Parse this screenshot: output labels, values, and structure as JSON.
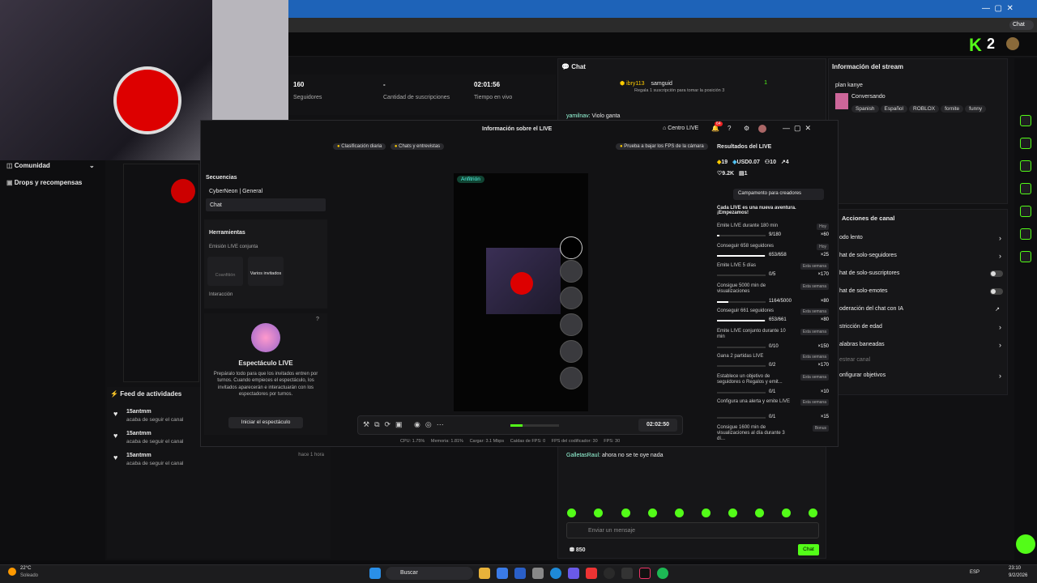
{
  "stats": [
    {
      "value": "160",
      "label": "Seguidores"
    },
    {
      "value": "-",
      "label": "Cantidad de suscripciones"
    },
    {
      "value": "02:01:56",
      "label": "Tiempo en vivo"
    }
  ],
  "leftnav": {
    "community": "Comunidad",
    "drops": "Drops y recompensas"
  },
  "chat": {
    "title": "Chat",
    "gift_user": "ibry113",
    "gift_count": "4",
    "gift_target": "samguid",
    "gift_rank": "1",
    "gift_text": "Regala 1 suscripción para tomar la posición 3",
    "messages": [
      {
        "user": "yamilnav:",
        "text": "Violo ganta"
      },
      {
        "user": "GalletasRaul:",
        "text": "ahora no se te oye nada"
      }
    ],
    "input_placeholder": "Enviar un mensaje",
    "points": "850",
    "send_label": "Chat"
  },
  "stream_info": {
    "title": "Información del stream",
    "streamer": "plan kanye",
    "category": "Conversando",
    "tags": [
      "Spanish",
      "Español",
      "ROBLOX",
      "fornite",
      "funny"
    ]
  },
  "actions": {
    "title": "Acciones de canal",
    "items": [
      {
        "label": "odo lento",
        "type": "arrow"
      },
      {
        "label": "hat de solo-seguidores",
        "type": "arrow"
      },
      {
        "label": "hat de solo-suscriptores",
        "type": "toggle"
      },
      {
        "label": "hat de solo-emotes",
        "type": "toggle"
      },
      {
        "label": "oderación del chat con IA",
        "type": "ext"
      },
      {
        "label": "stricción de edad",
        "type": "arrow"
      },
      {
        "label": "alabras baneadas",
        "type": "arrow"
      },
      {
        "label": "estear canal",
        "type": "none"
      },
      {
        "label": "onfigurar objetivos",
        "type": "arrow"
      }
    ]
  },
  "modal": {
    "title": "Información sobre el LIVE",
    "centro": "Centro LIVE",
    "notif_count": "64",
    "tabs": [
      "Clasificación diaria",
      "Chats y entrevistas"
    ],
    "fps_tip": "Prueba a bajar los FPS de la cámara",
    "sequences_title": "Secuencias",
    "sequences": [
      "CyberNeon | General",
      "Chat"
    ],
    "tools_title": "Herramientas",
    "joint_live": "Emisión LIVE conjunta",
    "cohost": "Coanfitión",
    "multi_guests": "Varios invitados",
    "interaction": "Interacción",
    "show_title": "Espectáculo LIVE",
    "show_desc": "Prepáralo todo para que los invitados entren por turnos. Cuando empieces el espectáculo, los invitados aparecerán e interactuarán con los espectadores por turnos.",
    "show_button": "Iniciar el espectáculo",
    "host_badge": "Anfitrión",
    "timer": "02:02:50",
    "status_bar": "CPU: 1.75%     Memoria: 1.81%     Cargar: 3.1 Mbps     Caídas de FPS: 0     FPS del codificador: 30     FPS: 30"
  },
  "results": {
    "title": "Resultados del LIVE",
    "gifts": "19",
    "usd": "USD0.07",
    "viewers": "10",
    "shares": "4",
    "likes": "9.2K",
    "gifters": "1",
    "campaign": "Campamento para creadores",
    "intro": "Cada LIVE es una nueva aventura. ¡Empezamos!",
    "missions": [
      {
        "name": "Emite LIVE durante 180 min",
        "badge": "Hoy",
        "progress": "9/180",
        "reward": "×60",
        "fraction": 0.05
      },
      {
        "name": "Conseguir 658 seguidores",
        "badge": "Hoy",
        "progress": "653/658",
        "reward": "×25",
        "fraction": 0.99
      },
      {
        "name": "Emite LIVE 5 días",
        "badge": "Esta semana",
        "progress": "0/5",
        "reward": "×170",
        "fraction": 0
      },
      {
        "name": "Consigue 5000 min de visualizaciones",
        "badge": "Esta semana",
        "progress": "1164/5000",
        "reward": "×80",
        "fraction": 0.23
      },
      {
        "name": "Conseguir 661 seguidores",
        "badge": "Esta semana",
        "progress": "653/661",
        "reward": "×80",
        "fraction": 0.99
      },
      {
        "name": "Emite LIVE conjunto durante 10 min",
        "badge": "Esta semana",
        "progress": "0/10",
        "reward": "×150",
        "fraction": 0
      },
      {
        "name": "Gana 2 partidas LIVE",
        "badge": "Esta semana",
        "progress": "0/2",
        "reward": "×170",
        "fraction": 0
      },
      {
        "name": "Establece un objetivo de seguidores o Regalos y emit...",
        "badge": "Esta semana",
        "progress": "0/1",
        "reward": "×10",
        "fraction": 0
      },
      {
        "name": "Configura una alerta y emite LIVE",
        "badge": "Esta semana",
        "progress": "0/1",
        "reward": "×15",
        "fraction": 0
      },
      {
        "name": "Consigue 1600 min de visualizaciones al día durante 3 dí...",
        "badge": "Bonus",
        "progress": "",
        "reward": "",
        "fraction": 0
      }
    ]
  },
  "feed": {
    "title": "Feed de actividades",
    "items": [
      {
        "user": "15antmm",
        "text": "acaba de seguir el canal",
        "time": ""
      },
      {
        "user": "15antmm",
        "text": "acaba de seguir el canal",
        "time": ""
      },
      {
        "user": "15antmm",
        "text": "acaba de seguir el canal",
        "time": "hace 1 hora"
      }
    ]
  },
  "taskbar": {
    "weather_temp": "22°C",
    "weather_desc": "Soleado",
    "search": "Buscar",
    "lang": "ESP",
    "time": "23:10",
    "date": "9/2/2026"
  },
  "kick_logo": "K",
  "kick_num": "2",
  "colors": {
    "accent": "#53fc18",
    "titlebar": "#1e63b8"
  }
}
